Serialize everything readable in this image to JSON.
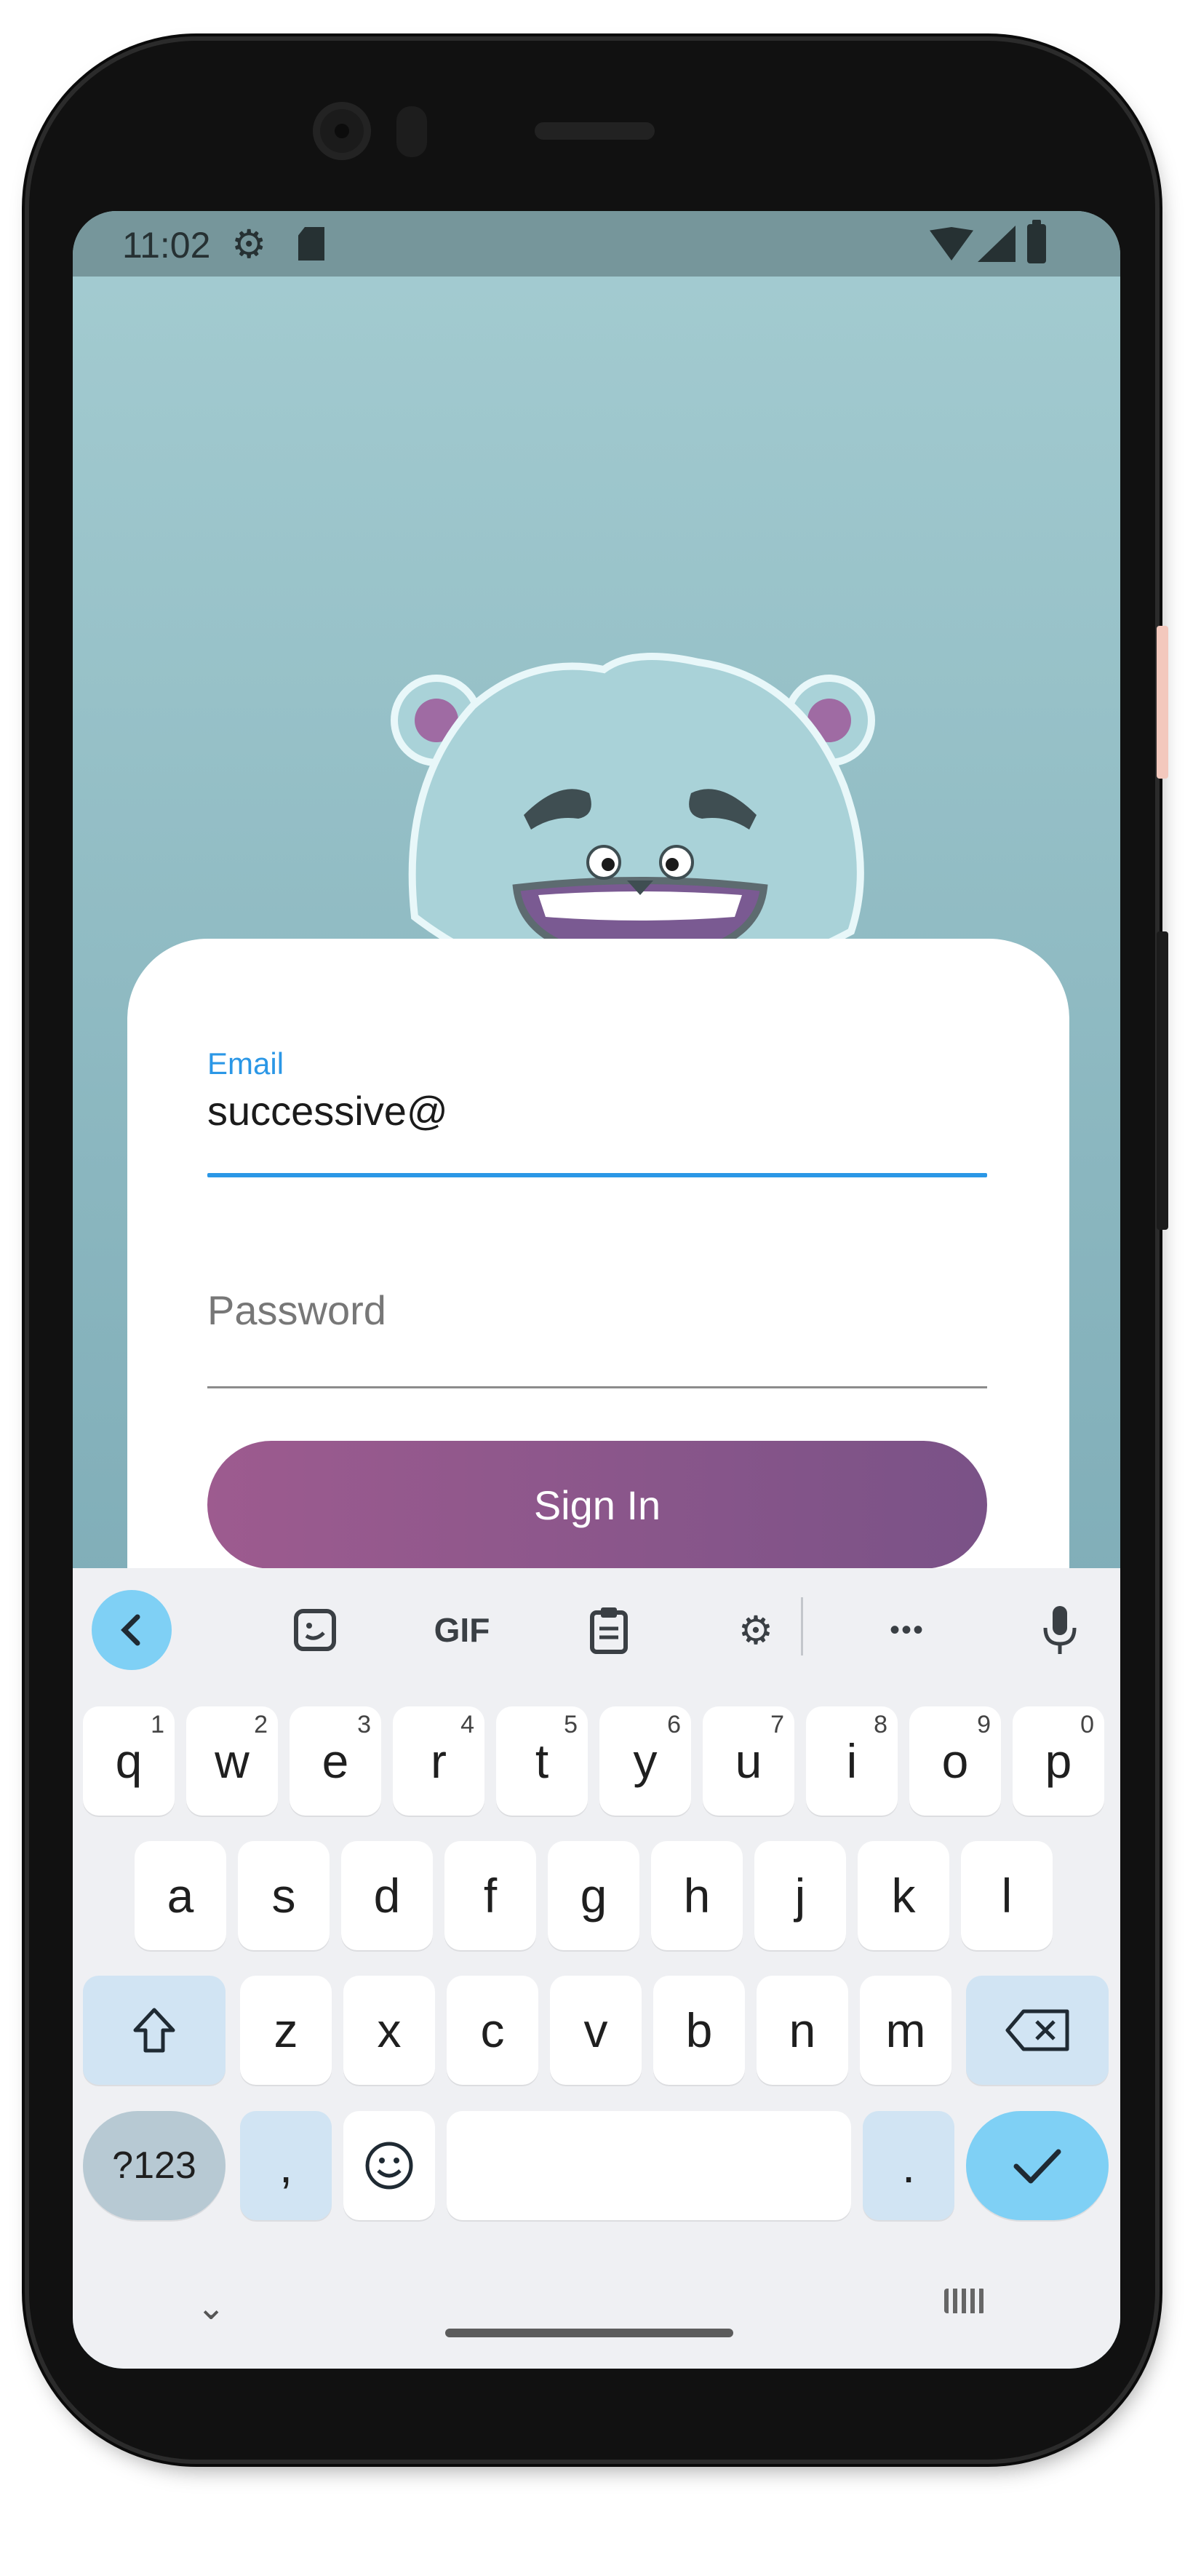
{
  "status_bar": {
    "time": "11:02",
    "icons": [
      "gear-icon",
      "sd-card-icon",
      "wifi-icon",
      "signal-icon",
      "battery-icon"
    ]
  },
  "form": {
    "email_label": "Email",
    "email_value": "successive@",
    "password_placeholder": "Password",
    "signin_label": "Sign In"
  },
  "colors": {
    "accent": "#2b97e6",
    "button_gradient_start": "#9d5b8f",
    "button_gradient_end": "#7a5287",
    "background_top": "#a4ccd1",
    "scarf": "#e91e63"
  },
  "keyboard": {
    "toolbar": [
      "back-icon",
      "sticker-icon",
      "GIF",
      "clipboard-icon",
      "gear-icon",
      "more-icon",
      "mic-icon"
    ],
    "gif_label": "GIF",
    "row1": [
      {
        "k": "q",
        "h": "1"
      },
      {
        "k": "w",
        "h": "2"
      },
      {
        "k": "e",
        "h": "3"
      },
      {
        "k": "r",
        "h": "4"
      },
      {
        "k": "t",
        "h": "5"
      },
      {
        "k": "y",
        "h": "6"
      },
      {
        "k": "u",
        "h": "7"
      },
      {
        "k": "i",
        "h": "8"
      },
      {
        "k": "o",
        "h": "9"
      },
      {
        "k": "p",
        "h": "0"
      }
    ],
    "row2": [
      "a",
      "s",
      "d",
      "f",
      "g",
      "h",
      "j",
      "k",
      "l"
    ],
    "row3": [
      "z",
      "x",
      "c",
      "v",
      "b",
      "n",
      "m"
    ],
    "row4": {
      "symbols": "?123",
      "comma": ",",
      "period": "."
    }
  }
}
